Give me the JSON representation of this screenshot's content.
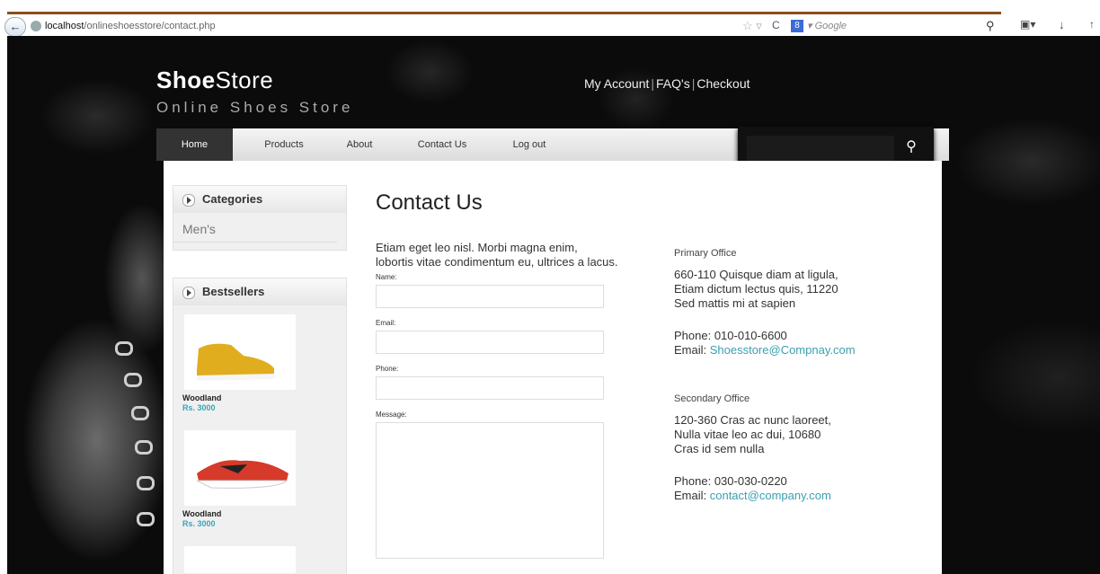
{
  "browser": {
    "url_host": "localhost",
    "url_path": "/onlineshoesstore/contact.php",
    "search_placeholder": "Google"
  },
  "header": {
    "logo_bold": "Shoe",
    "logo_light": "Store",
    "tagline": "Online Shoes Store",
    "links": [
      "My Account",
      "FAQ's",
      "Checkout"
    ]
  },
  "nav": {
    "items": [
      "Home",
      "Products",
      "About",
      "Contact Us",
      "Log out"
    ]
  },
  "sidebar": {
    "categories_title": "Categories",
    "categories": [
      "Men's"
    ],
    "bestsellers_title": "Bestsellers",
    "products": [
      {
        "name": "Woodland",
        "price": "Rs. 3000"
      },
      {
        "name": "Woodland",
        "price": "Rs. 3000"
      }
    ]
  },
  "contact": {
    "title": "Contact Us",
    "intro": "Etiam eget leo nisl. Morbi magna enim, lobortis vitae condimentum eu, ultrices a lacus.",
    "labels": {
      "name": "Name:",
      "email": "Email:",
      "phone": "Phone:",
      "message": "Message:"
    }
  },
  "offices": {
    "primary": {
      "heading": "Primary Office",
      "address": [
        "660-110 Quisque diam at ligula,",
        "Etiam dictum lectus quis, 11220",
        "Sed mattis mi at sapien"
      ],
      "phone": "Phone: 010-010-6600",
      "email_label": "Email: ",
      "email": "Shoesstore@Compnay.com"
    },
    "secondary": {
      "heading": "Secondary Office",
      "address": [
        "120-360 Cras ac nunc laoreet,",
        "Nulla vitae leo ac dui, 10680",
        "Cras id sem nulla"
      ],
      "phone": "Phone: 030-030-0220",
      "email_label": "Email: ",
      "email": "contact@company.com"
    }
  },
  "colors": {
    "accent": "#3aa0b0",
    "topbar": "#8a4e1c"
  }
}
